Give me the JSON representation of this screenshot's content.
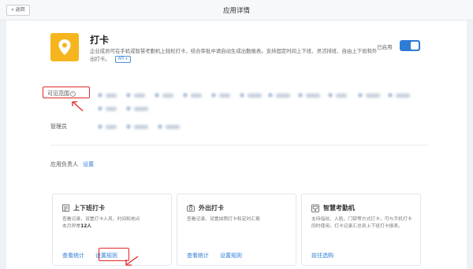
{
  "topbar": {
    "back_label": "« 返回",
    "title": "应用详情"
  },
  "app": {
    "name": "打卡",
    "description": "企业成员可在手机或智慧考勤机上轻松打卡，结合审批中请自动生成出勤报表。支持固定时间上下班、灵活排班、自由上下班和外出打卡。",
    "api_tag": "API ▾",
    "enabled_label": "已启用",
    "enabled": true
  },
  "scope": {
    "label": "可见范围",
    "info_icon": "i"
  },
  "admins": {
    "label": "管理员"
  },
  "owner": {
    "label": "应用负责人",
    "set_link": "设置"
  },
  "cards": [
    {
      "title": "上下班打卡",
      "icon": "calendar-list-icon",
      "desc_prefix": "查看记录、设置打卡人员、时间和地点",
      "desc_count_prefix": "本月异常",
      "desc_count": "12人",
      "link1": "查看统计",
      "link2": "设置规则"
    },
    {
      "title": "外出打卡",
      "icon": "camera-icon",
      "desc": "查看记录、设置拍照打卡和定时汇报",
      "link1": "查看统计",
      "link2": "设置规则"
    },
    {
      "title": "智慧考勤机",
      "icon": "attendance-machine-icon",
      "desc": "支持指纹、人脸、门禁等方式打卡，可与手机打卡同时使用，打卡记录汇总到上下班打卡报表。",
      "link1": "前往选购"
    }
  ],
  "colors": {
    "accent": "#2e7cd6",
    "app_icon": "#f6b51e",
    "highlight": "#e02727"
  }
}
